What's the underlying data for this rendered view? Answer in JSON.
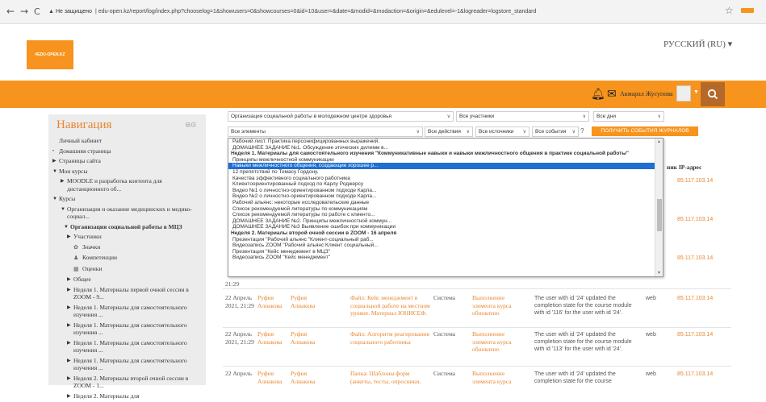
{
  "browser": {
    "security": "Не защищено",
    "url": "edu-open.kz/report/log/index.php?chooselog=1&showusers=0&showcourses=0&id=10&user=&date=&modid=&modaction=&origin=&edulevel=-1&logreader=logstore_standard"
  },
  "header": {
    "logo_text": "#EDU-OPEN.KZ",
    "language": "РУССКИЙ (RU) ▾",
    "user_name": "Акмарал Жусупова"
  },
  "nav": {
    "title": "Навигация",
    "items": [
      {
        "label": "Личный кабинет",
        "level": 0,
        "arrow": ""
      },
      {
        "label": "Домашняя страница",
        "level": 0,
        "arrow": "•"
      },
      {
        "label": "Страницы сайта",
        "level": 0,
        "arrow": "▶"
      },
      {
        "label": "Мои курсы",
        "level": 0,
        "arrow": "▼"
      },
      {
        "label": "MOODLE и разработка контента для дистанционного об...",
        "level": 1,
        "arrow": "▶"
      },
      {
        "label": "Курсы",
        "level": 0,
        "arrow": "▼"
      },
      {
        "label": "Организация и оказание медицинских и медико-социал...",
        "level": 1,
        "arrow": "▼"
      },
      {
        "label": "Организация социальной работы в МЦЗ",
        "level": 2,
        "arrow": "▼",
        "bold": true
      },
      {
        "label": "Участники",
        "level": 3,
        "arrow": "▶"
      },
      {
        "label": "Значки",
        "level": 3,
        "arrow": "",
        "glyph": "✿"
      },
      {
        "label": "Компетенции",
        "level": 3,
        "arrow": "",
        "glyph": "♟"
      },
      {
        "label": "Оценки",
        "level": 3,
        "arrow": "",
        "glyph": "▦"
      },
      {
        "label": "Общее",
        "level": 3,
        "arrow": "▶"
      },
      {
        "label": "Неделя 1. Материалы первой очной сессии в ZOOM - 9...",
        "level": 3,
        "arrow": "▶"
      },
      {
        "label": "Неделя 1. Материалы для самостоятельного изучения ...",
        "level": 3,
        "arrow": "▶"
      },
      {
        "label": "Неделя 1. Материалы для самостоятельного изучения ...",
        "level": 3,
        "arrow": "▶"
      },
      {
        "label": "Неделя 1. Материалы для самостоятельного изучения ...",
        "level": 3,
        "arrow": "▶"
      },
      {
        "label": "Неделя 1. Материалы для самостоятельного изучения ...",
        "level": 3,
        "arrow": "▶"
      },
      {
        "label": "Неделя 2. Материалы второй очной сессии в ZOOM - 1...",
        "level": 3,
        "arrow": "▶"
      },
      {
        "label": "Неделя 2. Материалы для",
        "level": 3,
        "arrow": "▶"
      }
    ]
  },
  "filters": {
    "course": "Организация социальной работы в молодежном центре здоровья",
    "participants": "Все участники",
    "days": "Все дни",
    "elements": "Все элементы",
    "actions": "Все действия",
    "sources": "Все источники",
    "events": "Все события",
    "get_logs": "Получить события журналов"
  },
  "dropdown": {
    "options": [
      {
        "label": "Рабочий лист. Практика персонифицированных выражений.",
        "type": "opt"
      },
      {
        "label": "ДОМАШНЕЕ ЗАДАНИЕ №1. Обсуждение этических дилемм в...",
        "type": "opt"
      },
      {
        "label": "Неделя 1. Материалы для самостоятельного изучения \"Коммуникативные навыки и навыки межличностного общения в практике социальной работы\"",
        "type": "grp"
      },
      {
        "label": "Принципы межличностной коммуникации",
        "type": "opt"
      },
      {
        "label": "Навыки межличностного общения, создающие хорошее р...",
        "type": "selected"
      },
      {
        "label": "12 препятствий по Томасу Гордону.",
        "type": "opt"
      },
      {
        "label": "Качества эффективного социального работника",
        "type": "opt"
      },
      {
        "label": "Клиентоориентированный подход по Карлу Роджерсу",
        "type": "opt"
      },
      {
        "label": "Видео №1 о личностно-ориентированном подходе Карла...",
        "type": "opt"
      },
      {
        "label": "Видео №2 о личностно-ориентированном подходе Карла...",
        "type": "opt"
      },
      {
        "label": "Рабочий альянс: некоторые исследовательские данные",
        "type": "opt"
      },
      {
        "label": "Список рекомендуемой литературы по коммуникациям",
        "type": "opt"
      },
      {
        "label": "Список рекомендуемой литературы по работе с клиенто...",
        "type": "opt"
      },
      {
        "label": "ДОМАШНЕЕ ЗАДАНИЕ №2. Принципы межличностной коммун...",
        "type": "opt"
      },
      {
        "label": "ДОМАШНЕЕ ЗАДАНИЕ №3 Выявление ошибок при коммуникации",
        "type": "opt"
      },
      {
        "label": "Неделя 2. Материалы второй очной сессии в ZOOM - 16 апреля",
        "type": "grp"
      },
      {
        "label": "Презентация \"Рабочий альянс \"Клиент-социальный раб...",
        "type": "opt"
      },
      {
        "label": "Видеозапись ZOOM \"Рабочий альянс Клиент социальный...",
        "type": "opt"
      },
      {
        "label": "Презентация \"Кейс менеджмент в МЦЗ\"",
        "type": "opt"
      },
      {
        "label": "Видеозапись ZOOM \"Кейс менеджмент\"",
        "type": "opt"
      }
    ]
  },
  "table": {
    "ip_header": "ник IP-адрес",
    "partial_ips": [
      "85.117.103.14",
      "85.117.103.14",
      "85.117.103.14"
    ],
    "partial_time": "21:29",
    "rows": [
      {
        "date": "22 Апрель 2021, 21:29",
        "user": "Руфия Алиакова",
        "affected": "Руфия Алиакова",
        "context": "Файл: Кейс менеджмент в социальной работе на местном уровне. Материал ЮНИСЕФ.",
        "component": "Система",
        "event": "Выполнение элемента курса обновлено",
        "description": "The user with id '24' updated the completion state for the course module with id '116' for the user with id '24'.",
        "origin": "web",
        "ip": "85.117.103.14"
      },
      {
        "date": "22 Апрель 2021, 21:29",
        "user": "Руфия Алиакова",
        "affected": "Руфия Алиакова",
        "context": "Файл: Алгоритм реагирования социального работника",
        "component": "Система",
        "event": "Выполнение элемента курса обновлено",
        "description": "The user with id '24' updated the completion state for the course module with id '113' for the user with id '24'.",
        "origin": "web",
        "ip": "85.117.103.14"
      },
      {
        "date": "22 Апрель",
        "user": "Руфия Алиакова",
        "affected": "Руфия Алиакова",
        "context": "Папка: Шаблоны форм (анкеты, тесты, опросники,",
        "component": "Система",
        "event": "Выполнение элемента курса",
        "description": "The user with id '24' updated the completion state for the course",
        "origin": "web",
        "ip": "85.117.103.14"
      }
    ]
  }
}
